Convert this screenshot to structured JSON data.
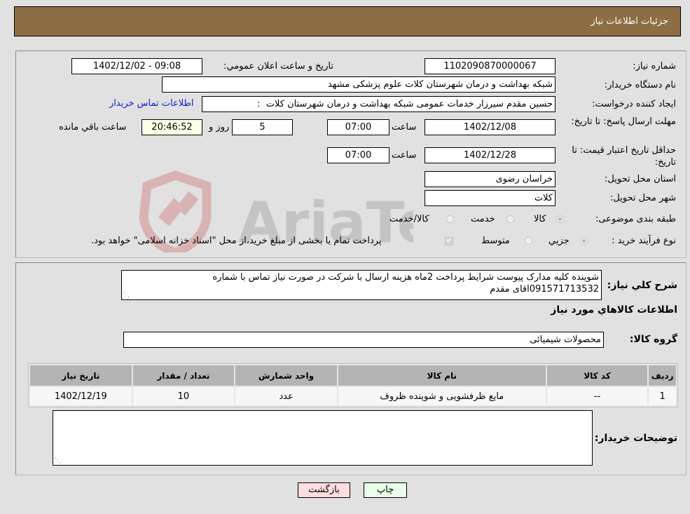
{
  "header": {
    "title": "جزئيات اطلاعات نياز"
  },
  "details": {
    "need_number": {
      "label": "شماره نياز:",
      "value": "1102090870000067"
    },
    "announce_datetime": {
      "label": "تاريخ و ساعت اعلان عمومي:",
      "value": "1402/12/02 - 09:08"
    },
    "buyer_org": {
      "label": "نام دستگاه خريدار:",
      "value": "شبکه بهداشت و درمان شهرستان کلات   علوم پزشکی مشهد"
    },
    "requester": {
      "label": "ايجاد کننده درخواست:",
      "value": "حسین مقدم سیرزار خدمات عمومی شبکه بهداشت و درمان شهرستان کلات",
      "separator": ":",
      "contact_link": "اطلاعات تماس خريدار"
    },
    "reply_deadline": {
      "label": "مهلت ارسال پاسخ: تا تاريخ:",
      "date": "1402/12/08",
      "time_label": "ساعت",
      "time": "07:00",
      "days": "5",
      "days_label": "روز و",
      "remaining": "20:46:52",
      "remaining_label": "ساعت باقي مانده"
    },
    "price_validity": {
      "label": "حداقل تاريخ اعتبار قيمت: تا تاريخ:",
      "date": "1402/12/28",
      "time_label": "ساعت",
      "time": "07:00"
    },
    "delivery_province": {
      "label": "استان محل تحويل:",
      "value": "خراسان رضوی"
    },
    "delivery_city": {
      "label": "شهر محل تحويل:",
      "value": "کلات"
    },
    "category": {
      "label": "طبقه بندی موضوعی:",
      "options": [
        {
          "label": "کالا",
          "selected": true
        },
        {
          "label": "خدمت",
          "selected": false
        },
        {
          "label": "کالا/خدمت",
          "selected": false
        }
      ]
    },
    "purchase_process": {
      "label": "نوع فرآيند خريد :",
      "options": [
        {
          "label": "جزيي",
          "selected": true
        },
        {
          "label": "متوسط",
          "selected": false
        }
      ],
      "treasury_checkbox": {
        "checked": true,
        "label": "پرداخت تمام يا بخشی از مبلغ خريد،از محل \"اسناد خزانه اسلامی\" خواهد بود."
      }
    }
  },
  "description": {
    "label": "شرح کلي نياز:",
    "value": "شوينده کليه مدارک پيوست شرايط پرداخت 2ماه هزينه ارسال با شرکت در صورت نياز تماس با شماره 09157171353‪2‬اقای مقدم"
  },
  "goods_section": {
    "title": "اطلاعات کالاهاي مورد نياز"
  },
  "goods_group": {
    "label": "گروه کالا:",
    "value": "محصولات شيميائی"
  },
  "items_table": {
    "columns": [
      "رديف",
      "کد کالا",
      "نام کالا",
      "واحد شمارش",
      "تعداد / مقدار",
      "تاريخ نياز"
    ],
    "rows": [
      [
        "1",
        "--",
        "مايع ظرفشويی و شوينده ظروف",
        "عدد",
        "10",
        "1402/12/19"
      ]
    ]
  },
  "buyer_notes": {
    "label": "توضيحات خريدار:",
    "value": ""
  },
  "buttons": {
    "print": "چاپ",
    "back": "بازگشت"
  },
  "colors": {
    "header_bg": "#8c6d44",
    "print_bg": "#eaffea",
    "back_bg": "#ffdede",
    "link": "#1a1acc"
  }
}
